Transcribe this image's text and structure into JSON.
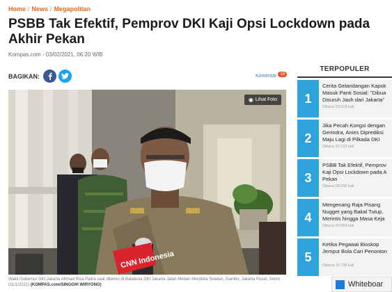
{
  "breadcrumb": [
    "Home",
    "News",
    "Megapolitan"
  ],
  "article": {
    "title": "PSBB Tak Efektif, Pemprov DKI Kaji Opsi Lockdown pada Akhir Pekan",
    "meta": "Kompas.com - 03/02/2021, 06:20 WIB"
  },
  "share": {
    "label": "BAGIKAN:",
    "facebook_icon": "facebook-icon",
    "twitter_icon": "twitter-icon"
  },
  "comments": {
    "label": "Komentar",
    "count": "18"
  },
  "photo": {
    "view_label": "Lihat Foto",
    "caption": "Wakil Gubernur DKI Jakarta Ahmad Riza Patria saat ditemui di Balaikota DKI Jakarta Jalan Medan Merdeka Selatan, Gambir, Jakarta Pusat, Senin (11/1/2021)",
    "credit": "(KOMPAS.com/SINGGIH WIRYONO)",
    "mic_logo": "CNN Indonesia"
  },
  "sidebar": {
    "title": "TERPOPULER",
    "items": [
      {
        "num": "1",
        "lines": [
          "Cerita Gelandangan Kapok",
          "Masuk Panti Sosial: \"Dibua",
          "Disuruh Jauh dari Jakarta\""
        ],
        "views": "Dibaca 33.018 kali"
      },
      {
        "num": "2",
        "lines": [
          "Jika Pecah Kongsi dengan",
          "Gerindra, Anies Diprediksi",
          "Maju Lagi di Pilkada DKI"
        ],
        "views": "Dibaca 32.124 kali"
      },
      {
        "num": "3",
        "lines": [
          "PSBB Tak Efektif, Pemprov",
          "Kaji Opsi Lockdown pada A",
          "Pekan"
        ],
        "views": "Dibaca 28.242 kali"
      },
      {
        "num": "4",
        "lines": [
          "Mengenang Raja Pisang",
          "Nugget yang Bakal Tutup,",
          "Merintis hingga Masa Keja"
        ],
        "views": "Dibaca 20.654 kali"
      },
      {
        "num": "5",
        "lines": [
          "Ketika Pegawai Bioskop",
          "Jemput Bola Cari Penonton"
        ],
        "views": "Dibaca 19.738 kali"
      }
    ]
  },
  "popup": {
    "label": "Whiteboar"
  },
  "colors": {
    "accent_orange": "#e86a1c",
    "popular_blue": "#2fa3d9",
    "facebook": "#3b5998",
    "twitter": "#1da1f2"
  }
}
